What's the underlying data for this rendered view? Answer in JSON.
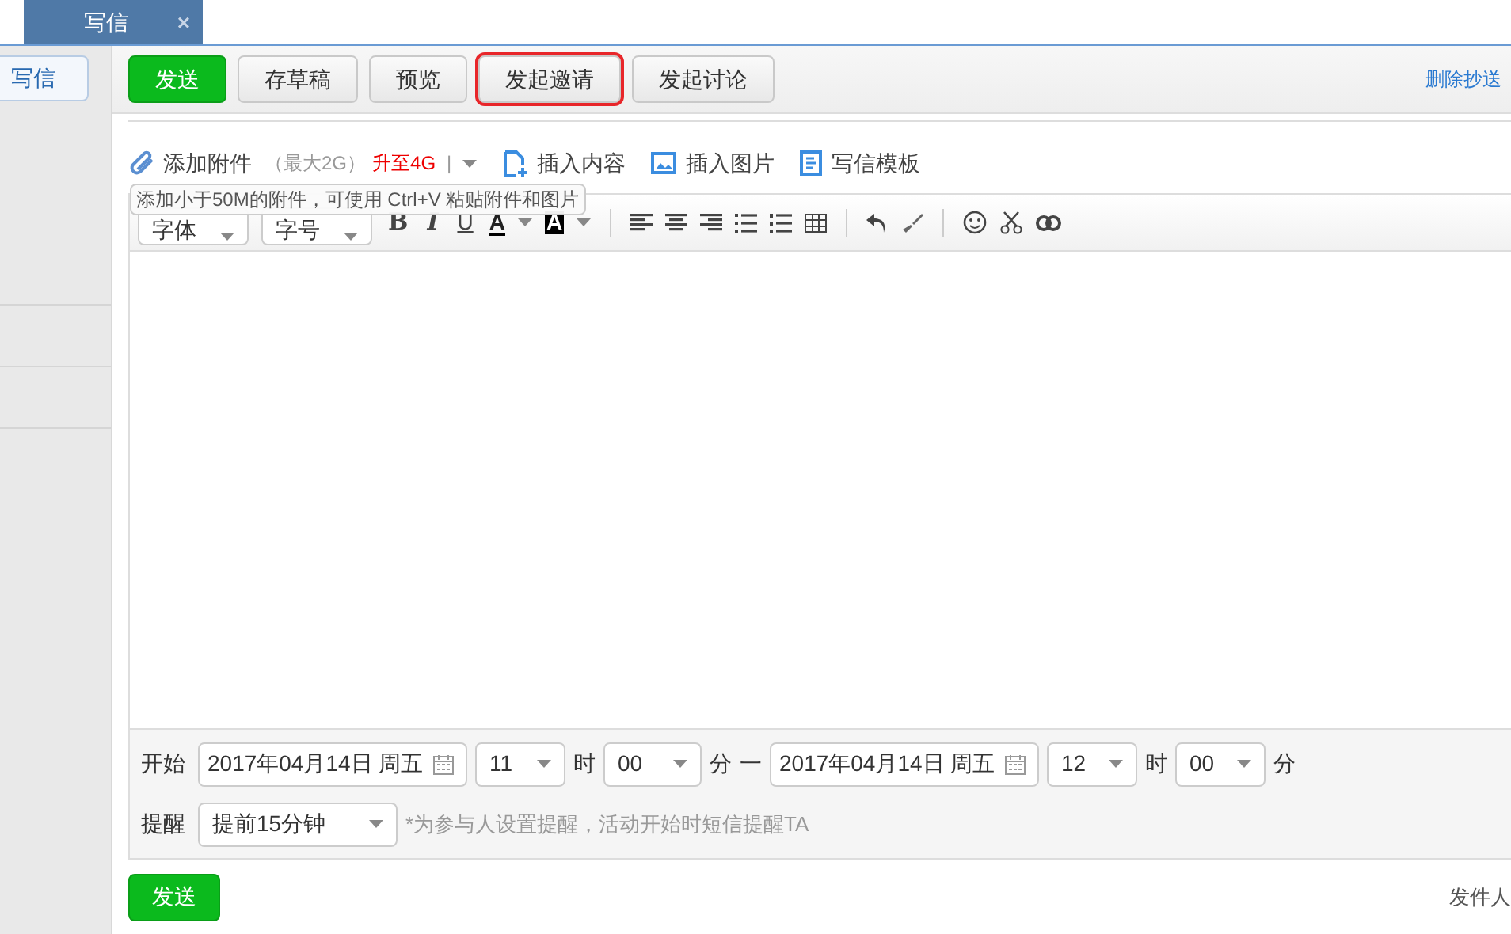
{
  "tab": {
    "title": "写信",
    "close": "×"
  },
  "sidebar": {
    "compose": "写信"
  },
  "toolbar": {
    "buttons": [
      {
        "label": "发送",
        "kind": "primary",
        "highlighted": false
      },
      {
        "label": "存草稿",
        "kind": "default",
        "highlighted": false
      },
      {
        "label": "预览",
        "kind": "default",
        "highlighted": false
      },
      {
        "label": "发起邀请",
        "kind": "default",
        "highlighted": true
      },
      {
        "label": "发起讨论",
        "kind": "default",
        "highlighted": false
      }
    ],
    "link": "删除抄送"
  },
  "attach": {
    "label": "添加附件",
    "limit": "（最大2G）",
    "upgrade": "升至4G",
    "sep": "|",
    "tooltip": "添加小于50M的附件，可使用 Ctrl+V 粘贴附件和图片"
  },
  "insert": [
    {
      "label": "插入内容",
      "kind": "content"
    },
    {
      "label": "插入图片",
      "kind": "image"
    },
    {
      "label": "写信模板",
      "kind": "template"
    }
  ],
  "editor": {
    "font": "字体",
    "size": "字号",
    "format": [
      "B",
      "I",
      "U",
      "A",
      "A"
    ]
  },
  "event": {
    "start_label": "开始",
    "start_date": "2017年04月14日 周五",
    "start_hour": "11",
    "hour_unit": "时",
    "start_min": "00",
    "min_unit": "分",
    "dash": "一",
    "end_date": "2017年04月14日 周五",
    "end_hour": "12",
    "end_hour_unit": "时",
    "end_min": "00",
    "end_min_unit": "分",
    "remind_label": "提醒",
    "remind": "提前15分钟",
    "remind_note": "*为参与人设置提醒，活动开始时短信提醒TA"
  },
  "footer": {
    "send": "发送",
    "sender": "发件人"
  }
}
